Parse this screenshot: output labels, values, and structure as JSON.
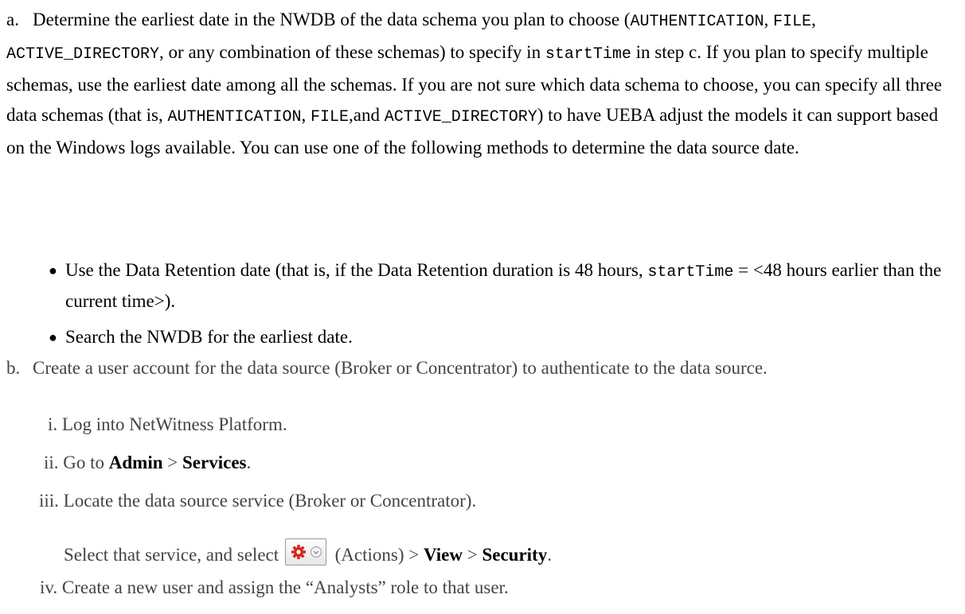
{
  "step_a": {
    "marker": "a.",
    "text_1": "Determine the earliest date in the NWDB of the data schema you plan to choose (",
    "schema_authentication": "AUTHENTICATION",
    "comma_1": ", ",
    "schema_file": "FILE",
    "comma_2": ", ",
    "schema_active_directory": "ACTIVE_DIRECTORY",
    "text_2": ", or any combination of these schemas) to specify in ",
    "code_starttime": "startTime",
    "text_3": " in step c. If you plan to specify multiple schemas, use the earliest date among all the schemas. If you are not sure which data schema to choose, you can specify all three data schemas (that is, ",
    "schema_authentication_2": "AUTHENTICATION",
    "comma_3": ", ",
    "schema_file_2": "FILE",
    "comma_4": ",and ",
    "schema_active_directory_2": "ACTIVE_DIRECTORY",
    "text_4": ") to have UEBA adjust the models it can support based on the Windows logs available. You can use one of the following methods to determine the data source date.",
    "bullets": {
      "b1_text_1": "Use the Data Retention date (that is, if the Data Retention duration is 48 hours, ",
      "b1_code": "startTime",
      "b1_text_2": " = <48 hours earlier than the current time>).",
      "b2_text": "Search the NWDB for the earliest date."
    }
  },
  "step_b": {
    "marker": "b.",
    "text": "Create a user account for the data source (Broker or Concentrator) to authenticate to the data source.",
    "substeps": {
      "i_marker": "i.",
      "i_text": "Log into NetWitness Platform.",
      "ii_marker": "ii.",
      "ii_text_1": "Go to ",
      "ii_admin": "Admin",
      "ii_sep": " > ",
      "ii_services": "Services",
      "ii_end": ".",
      "iii_marker": "iii.",
      "iii_text": "Locate the data source service (Broker or Concentrator).",
      "iii_select_1": "Select that service, and select ",
      "iii_actions": " (Actions) > ",
      "iii_view": "View",
      "iii_sep": " > ",
      "iii_security": "Security",
      "iii_end": ".",
      "iv_marker": "iv.",
      "iv_text": "Create a new user and assign the “Analysts” role to that user."
    }
  },
  "icons": {
    "actions_gear": "gear-icon",
    "actions_chevron": "chevron-down-icon",
    "gear_color": "#d42a1f"
  }
}
